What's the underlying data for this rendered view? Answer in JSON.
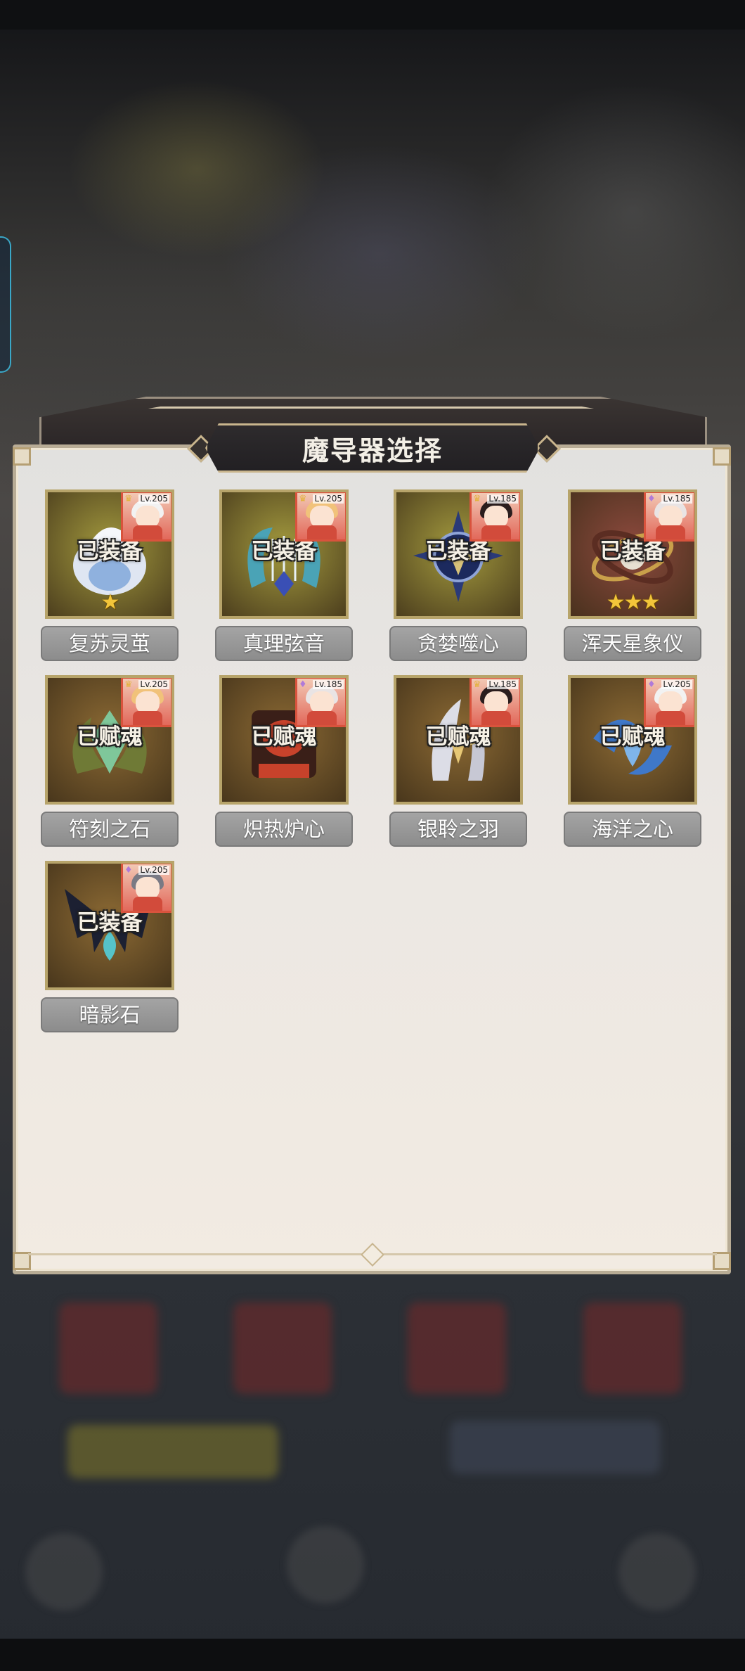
{
  "dialog": {
    "title": "魔导器选择"
  },
  "items": [
    {
      "name": "复苏灵茧",
      "status": "已装备",
      "stars": "★",
      "level": "Lv.205",
      "badge": "crown",
      "theme": "gold",
      "art": "swan-cocoon"
    },
    {
      "name": "真理弦音",
      "status": "已装备",
      "stars": "",
      "level": "Lv.205",
      "badge": "crown",
      "theme": "gold",
      "art": "lyre"
    },
    {
      "name": "贪婪噬心",
      "status": "已装备",
      "stars": "",
      "level": "Lv.185",
      "badge": "crown",
      "theme": "gold",
      "art": "star-orb"
    },
    {
      "name": "浑天星象仪",
      "status": "已装备",
      "stars": "★★★",
      "level": "Lv.185",
      "badge": "gem",
      "theme": "red",
      "art": "armillary"
    },
    {
      "name": "符刻之石",
      "status": "已赋魂",
      "stars": "",
      "level": "Lv.205",
      "badge": "crown",
      "theme": "brown",
      "art": "rune-stone"
    },
    {
      "name": "炽热炉心",
      "status": "已赋魂",
      "stars": "",
      "level": "Lv.185",
      "badge": "gem",
      "theme": "brown",
      "art": "furnace"
    },
    {
      "name": "银聆之羽",
      "status": "已赋魂",
      "stars": "",
      "level": "Lv.185",
      "badge": "crown",
      "theme": "brown",
      "art": "silver-feather"
    },
    {
      "name": "海洋之心",
      "status": "已赋魂",
      "stars": "",
      "level": "Lv.205",
      "badge": "gem",
      "theme": "brown",
      "art": "ocean-heart"
    },
    {
      "name": "暗影石",
      "status": "已装备",
      "stars": "",
      "level": "Lv.205",
      "badge": "gem",
      "theme": "brown",
      "art": "shadow-wings"
    }
  ],
  "colors": {
    "gold": "#a39a3e",
    "red": "#8e4a3e",
    "brown": "#8c6a34"
  }
}
